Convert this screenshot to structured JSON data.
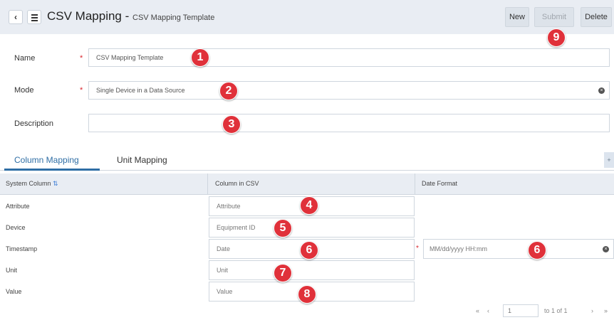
{
  "header": {
    "title": "CSV Mapping",
    "title_separator": " - ",
    "subtitle": "CSV Mapping Template",
    "new_label": "New",
    "submit_label": "Submit",
    "delete_label": "Delete"
  },
  "form": {
    "name_label": "Name",
    "name_value": "CSV Mapping Template",
    "mode_label": "Mode",
    "mode_value": "Single Device in a Data Source",
    "description_label": "Description",
    "description_value": "",
    "required_mark": "*"
  },
  "tabs": [
    {
      "label": "Column Mapping",
      "active": true
    },
    {
      "label": "Unit Mapping",
      "active": false
    }
  ],
  "side_toggle": "+",
  "table": {
    "headers": [
      "System Column",
      "Column in CSV",
      "Date Format"
    ],
    "rows": [
      {
        "system": "Attribute",
        "csv": "Attribute"
      },
      {
        "system": "Device",
        "csv": "Equipment ID"
      },
      {
        "system": "Timestamp",
        "csv": "Date",
        "date_format": "MM/dd/yyyy HH:mm"
      },
      {
        "system": "Unit",
        "csv": "Unit"
      },
      {
        "system": "Value",
        "csv": "Value"
      }
    ]
  },
  "pager": {
    "first": "«",
    "prev": "‹",
    "page": "1",
    "summary": "to 1 of 1",
    "next": "›",
    "last": "»"
  },
  "badges": [
    "1",
    "2",
    "3",
    "4",
    "5",
    "6",
    "6",
    "7",
    "8",
    "9"
  ],
  "colors": {
    "accent": "#2f6ea5",
    "badge": "#e0313a",
    "header_bg": "#e9edf3",
    "required": "#d9272e"
  },
  "icons": [
    "back-arrow-icon",
    "hamburger-menu-icon",
    "clear-icon",
    "sort-icon"
  ]
}
